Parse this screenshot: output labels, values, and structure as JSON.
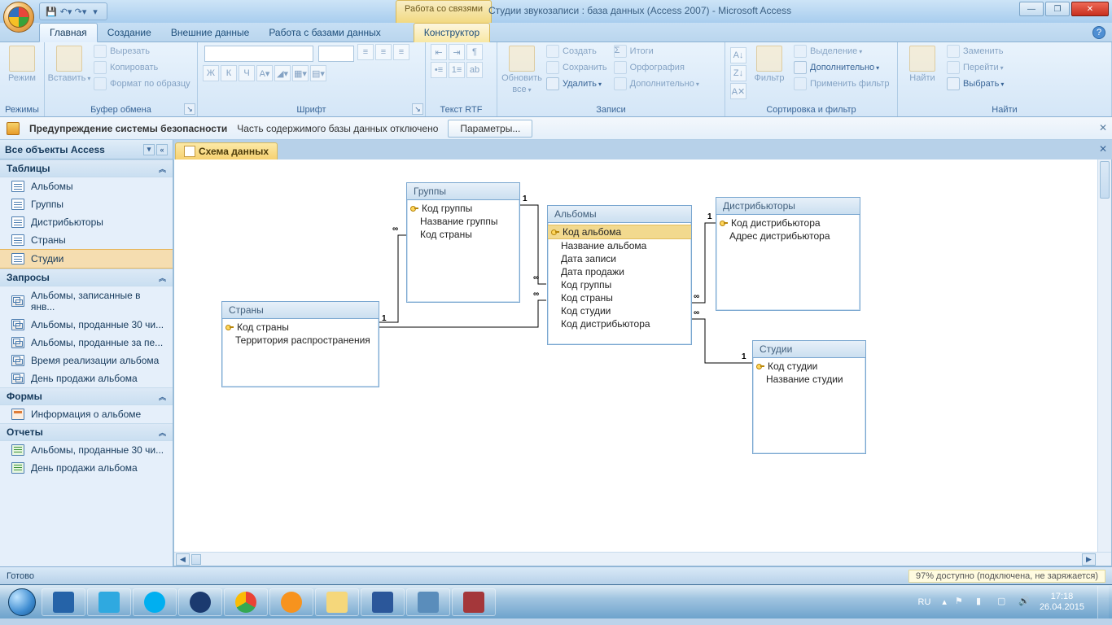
{
  "titlebar": {
    "context_tab": "Работа со связями",
    "app_title": "Студии звукозаписи : база данных (Access 2007) - Microsoft Access"
  },
  "ribbon_tabs": {
    "home": "Главная",
    "create": "Создание",
    "external": "Внешние данные",
    "dbtools": "Работа с базами данных",
    "designer": "Конструктор"
  },
  "ribbon": {
    "modes": {
      "label": "Режимы",
      "view": "Режим"
    },
    "clipboard": {
      "label": "Буфер обмена",
      "paste": "Вставить",
      "cut": "Вырезать",
      "copy": "Копировать",
      "format": "Формат по образцу"
    },
    "font": {
      "label": "Шрифт",
      "bold": "Ж",
      "italic": "К",
      "underline": "Ч"
    },
    "rtf": {
      "label": "Текст RTF"
    },
    "records": {
      "label": "Записи",
      "refresh": "Обновить",
      "refresh_all": "все",
      "new": "Создать",
      "save": "Сохранить",
      "delete": "Удалить",
      "totals": "Итоги",
      "spelling": "Орфография",
      "more": "Дополнительно"
    },
    "sortfilter": {
      "label": "Сортировка и фильтр",
      "filter": "Фильтр",
      "selection": "Выделение",
      "advanced": "Дополнительно",
      "toggle": "Применить фильтр"
    },
    "find": {
      "label": "Найти",
      "find": "Найти",
      "replace": "Заменить",
      "goto": "Перейти",
      "select": "Выбрать"
    }
  },
  "security": {
    "title": "Предупреждение системы безопасности",
    "msg": "Часть содержимого базы данных отключено",
    "button": "Параметры..."
  },
  "nav": {
    "header": "Все объекты Access",
    "tables_h": "Таблицы",
    "tables": [
      "Альбомы",
      "Группы",
      "Дистрибьюторы",
      "Страны",
      "Студии"
    ],
    "queries_h": "Запросы",
    "queries": [
      "Альбомы, записанные в янв...",
      "Альбомы, проданные 30 чи...",
      "Альбомы, проданные за пе...",
      "Время реализации альбома",
      "День продажи альбома"
    ],
    "forms_h": "Формы",
    "forms": [
      "Информация о альбоме"
    ],
    "reports_h": "Отчеты",
    "reports": [
      "Альбомы, проданные 30 чи...",
      "День продажи альбома"
    ]
  },
  "doc_tab": "Схема данных",
  "diagram": {
    "groups": {
      "title": "Группы",
      "fields": [
        "Код группы",
        "Название группы",
        "Код страны"
      ],
      "pk": [
        0
      ]
    },
    "albums": {
      "title": "Альбомы",
      "fields": [
        "Код альбома",
        "Название альбома",
        "Дата записи",
        "Дата продажи",
        "Код группы",
        "Код страны",
        "Код студии",
        "Код дистрибьютора"
      ],
      "pk": [
        0
      ],
      "selected": 0
    },
    "distrib": {
      "title": "Дистрибьюторы",
      "fields": [
        "Код дистрибьютора",
        "Адрес дистрибьютора"
      ],
      "pk": [
        0
      ]
    },
    "countries": {
      "title": "Страны",
      "fields": [
        "Код страны",
        "Территория распространения"
      ],
      "pk": [
        0
      ]
    },
    "studios": {
      "title": "Студии",
      "fields": [
        "Код студии",
        "Название студии"
      ],
      "pk": [
        0
      ]
    }
  },
  "rel_labels": {
    "one": "1",
    "many": "∞"
  },
  "status": {
    "ready": "Готово",
    "battery": "97% доступно (подключена, не заряжается)"
  },
  "tray": {
    "lang": "RU",
    "time": "17:18",
    "date": "26.04.2015"
  }
}
